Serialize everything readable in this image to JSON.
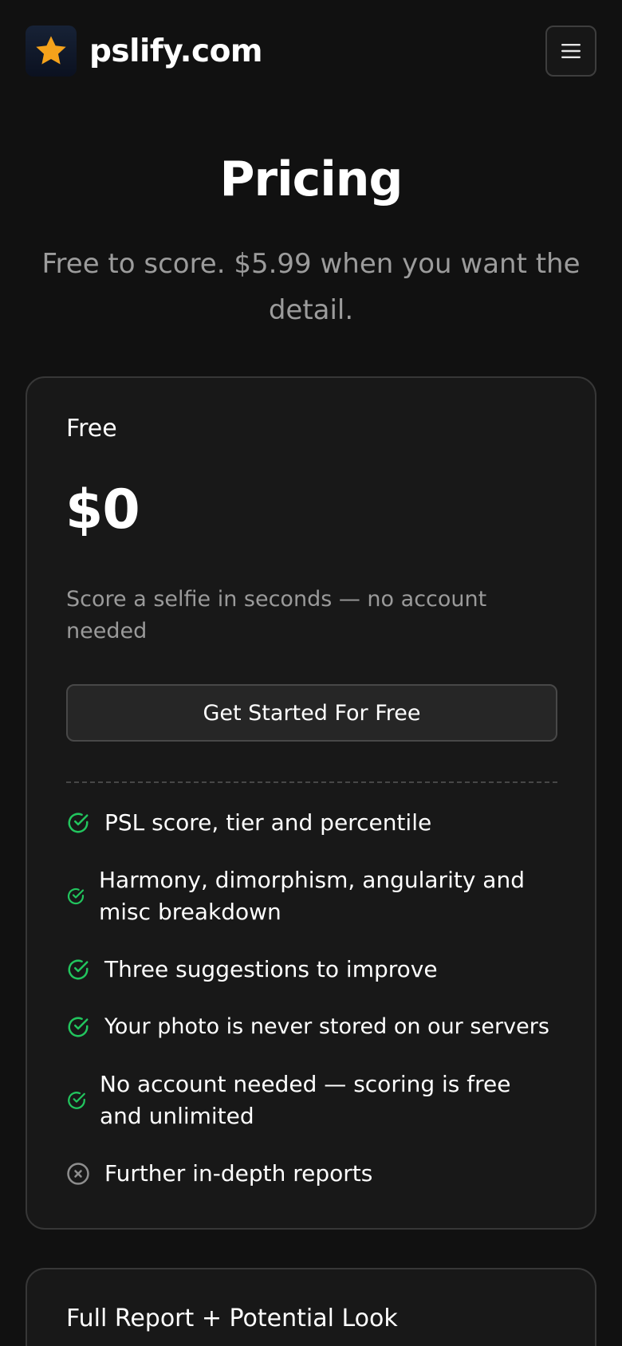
{
  "header": {
    "brand_name": "pslify.com",
    "logo_icon": "star-icon",
    "menu_icon": "hamburger-menu-icon"
  },
  "hero": {
    "title": "Pricing",
    "subtitle": "Free to score. $5.99 when you want the detail."
  },
  "plans": [
    {
      "name": "Free",
      "price": "$0",
      "description": "Score a selfie in seconds — no account needed",
      "cta_label": "Get Started For Free",
      "features": [
        {
          "text": "PSL score, tier and percentile",
          "included": true
        },
        {
          "text": "Harmony, dimorphism, angularity and misc breakdown",
          "included": true
        },
        {
          "text": "Three suggestions to improve",
          "included": true
        },
        {
          "text": "Your photo is never stored on our servers",
          "included": true
        },
        {
          "text": "No account needed — scoring is free and unlimited",
          "included": true
        },
        {
          "text": "Further in-depth reports",
          "included": false
        }
      ]
    },
    {
      "name": "Full Report + Potential Look"
    }
  ],
  "colors": {
    "background": "#111111",
    "card": "#181818",
    "check_green": "#22c55e",
    "cross_gray": "#8e8e8e",
    "logo_star": "#f5a21b"
  }
}
